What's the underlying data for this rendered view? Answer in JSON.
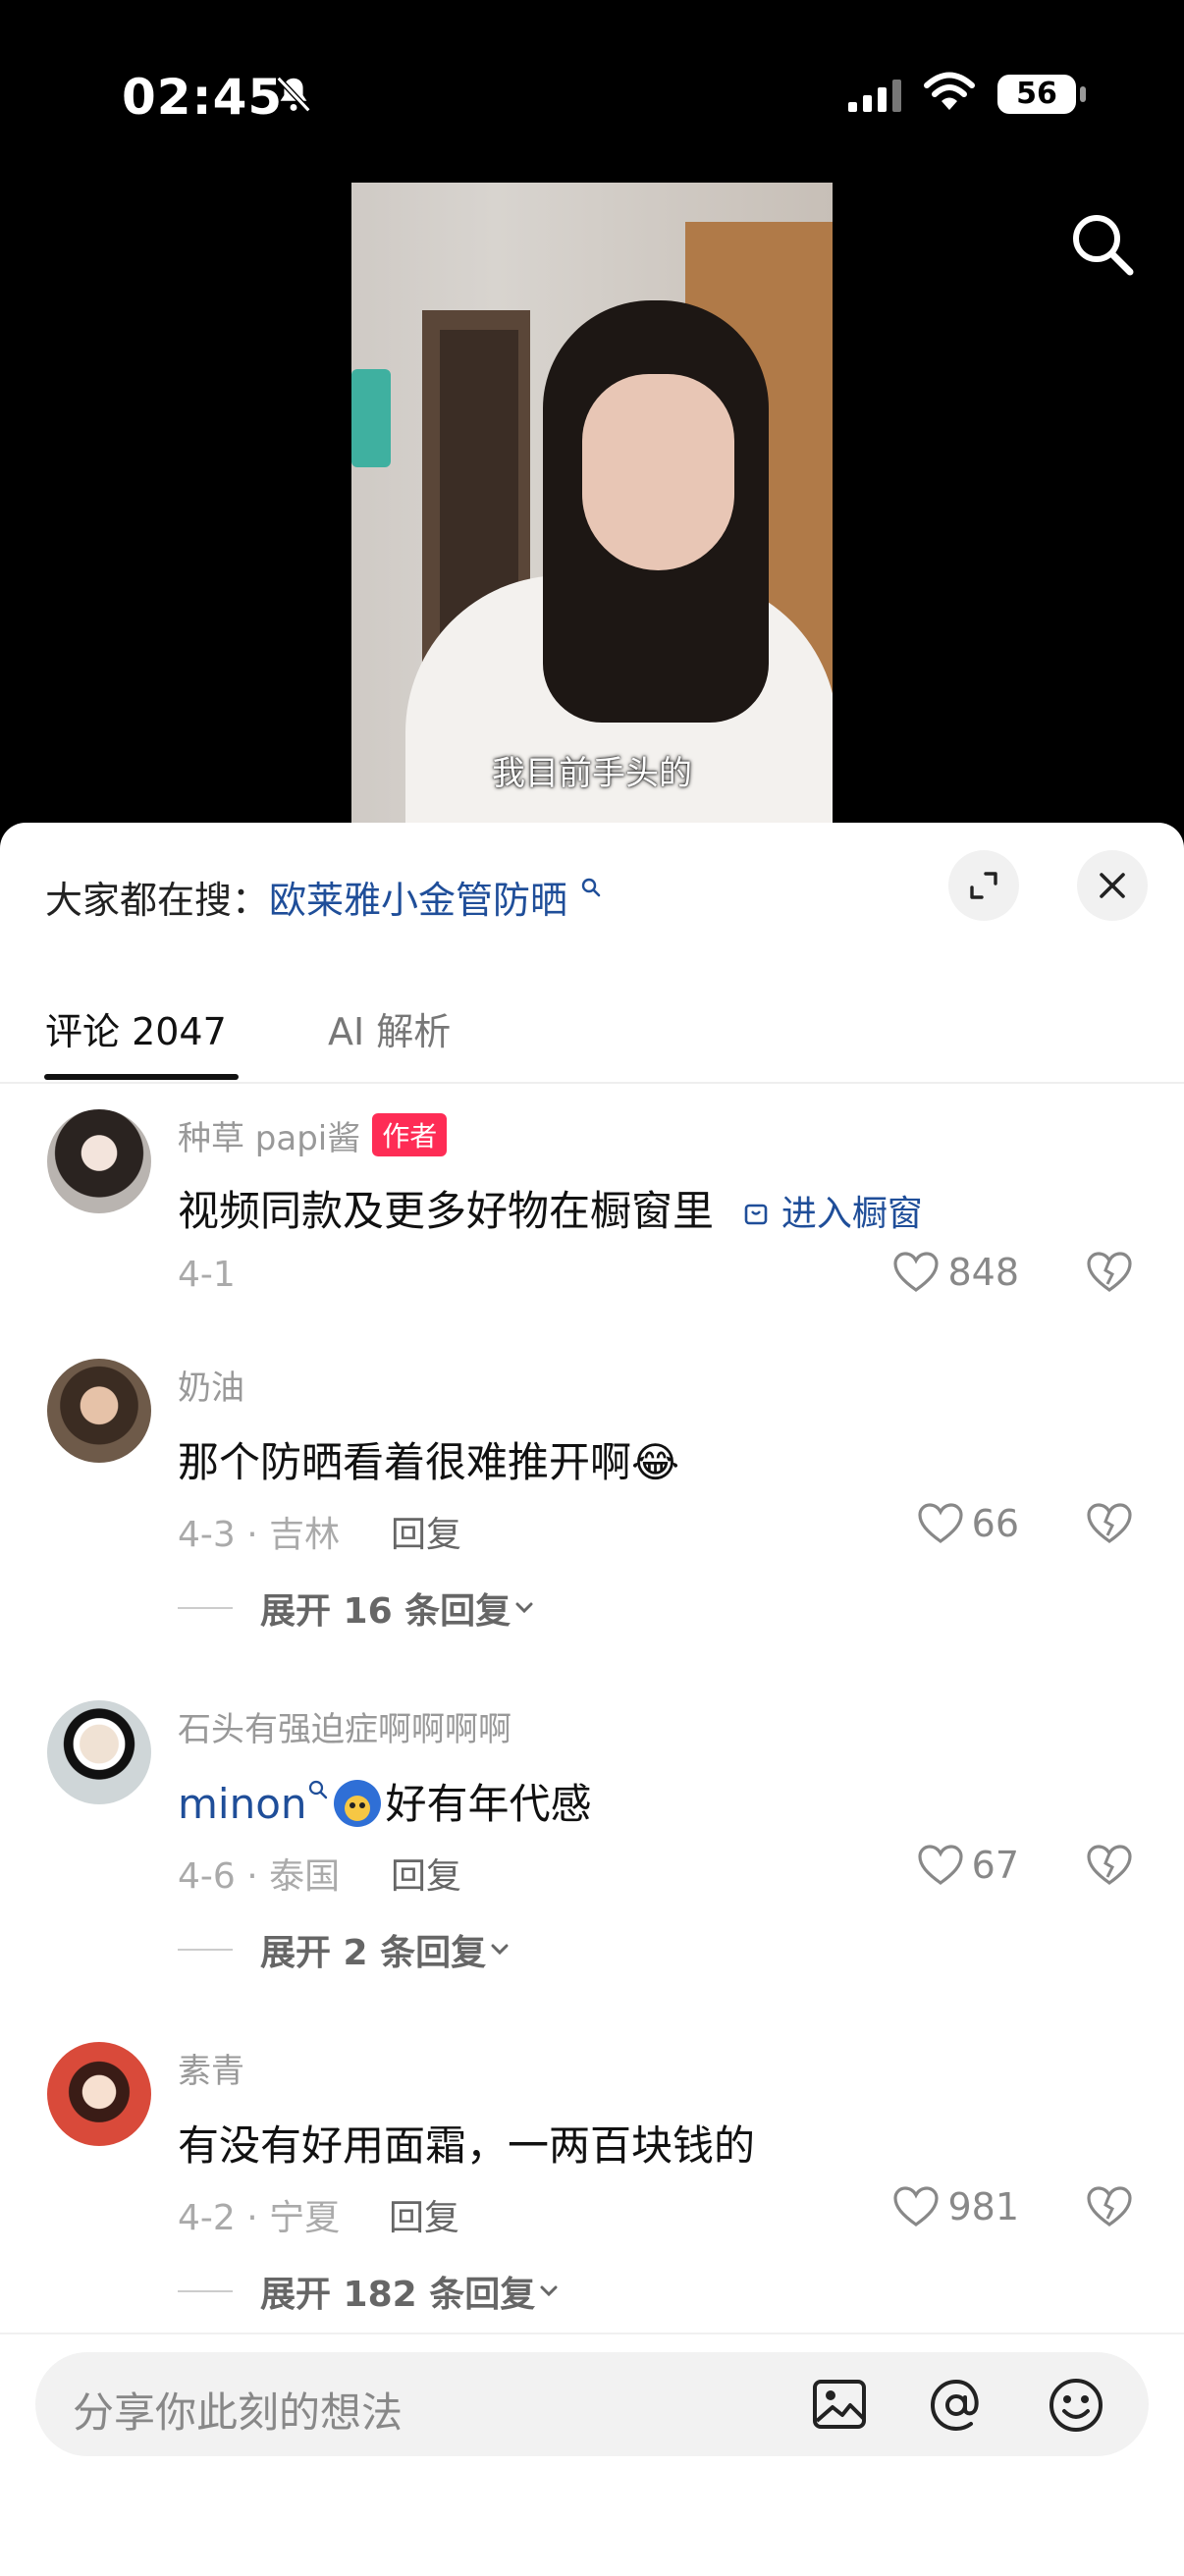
{
  "status_bar": {
    "time": "02:45",
    "battery": "56"
  },
  "video": {
    "caption": "我目前手头的"
  },
  "trending": {
    "prefix": "大家都在搜：",
    "query": "欧莱雅小金管防晒"
  },
  "tabs": [
    {
      "label": "评论 2047"
    },
    {
      "label": "AI 解析"
    }
  ],
  "comments": [
    {
      "user": "种草 papi酱",
      "badge": "作者",
      "text": "视频同款及更多好物在橱窗里",
      "link": "进入橱窗",
      "date": "4-1",
      "likes": "848"
    },
    {
      "user": "奶油",
      "text": "那个防晒看着很难推开啊😂",
      "date": "4-3 · 吉林",
      "reply": "回复",
      "likes": "66",
      "expand": "展开 16 条回复"
    },
    {
      "user": "石头有强迫症啊啊啊啊",
      "mention": "minon",
      "text": "好有年代感",
      "date": "4-6 · 泰国",
      "reply": "回复",
      "likes": "67",
      "expand": "展开 2 条回复"
    },
    {
      "user": "素青",
      "text": "有没有好用面霜，一两百块钱的",
      "date": "4-2 · 宁夏",
      "reply": "回复",
      "likes": "981",
      "expand": "展开 182 条回复"
    }
  ],
  "input": {
    "placeholder": "分享你此刻的想法"
  },
  "colors": {
    "author_badge": "#fe2c55",
    "link_blue": "#1f4e99"
  }
}
